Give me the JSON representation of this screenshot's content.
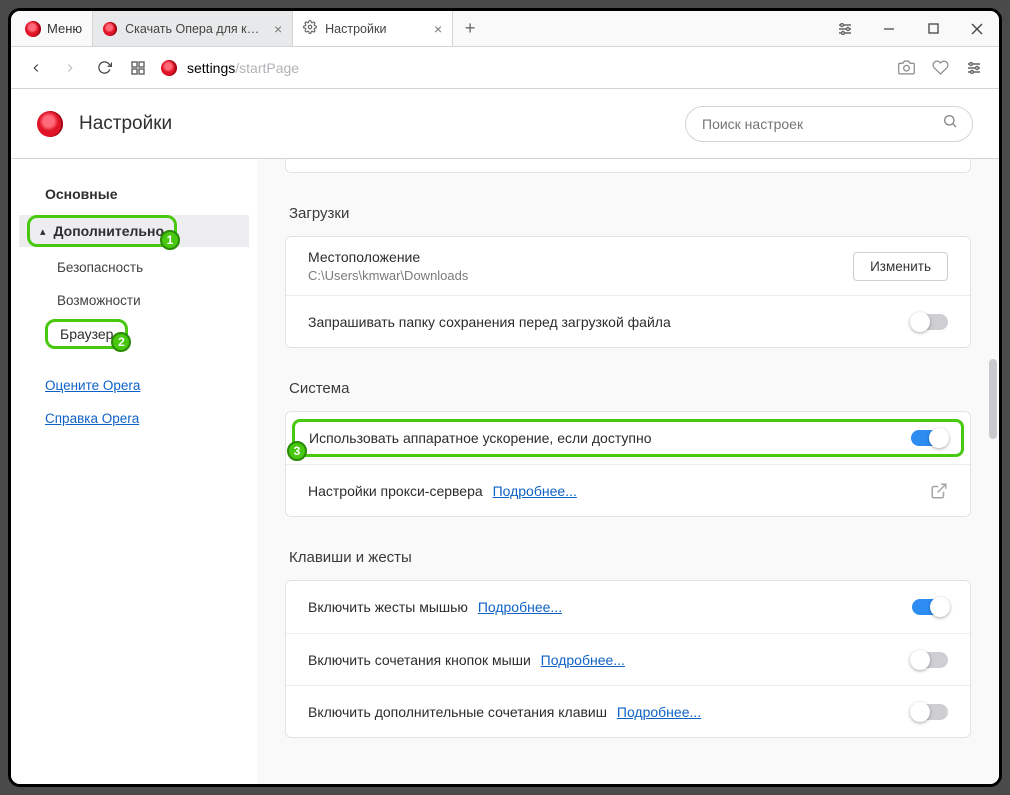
{
  "window": {
    "menu_label": "Меню",
    "tabs": [
      {
        "title": "Скачать Опера для компьютера",
        "icon": "opera"
      },
      {
        "title": "Настройки",
        "icon": "gear"
      }
    ]
  },
  "addressbar": {
    "url_prefix": "settings",
    "url_rest": "/startPage"
  },
  "header": {
    "title": "Настройки",
    "search_placeholder": "Поиск настроек"
  },
  "sidebar": {
    "basic": "Основные",
    "advanced": "Дополнительно",
    "security": "Безопасность",
    "features": "Возможности",
    "browser": "Браузер",
    "rate": "Оцените Opera",
    "help": "Справка Opera"
  },
  "callouts": {
    "n1": "1",
    "n2": "2",
    "n3": "3"
  },
  "sections": {
    "downloads": {
      "title": "Загрузки",
      "location_label": "Местоположение",
      "location_value": "C:\\Users\\kmwar\\Downloads",
      "change_btn": "Изменить",
      "ask_before": "Запрашивать папку сохранения перед загрузкой файла"
    },
    "system": {
      "title": "Система",
      "hw_accel": "Использовать аппаратное ускорение, если доступно",
      "proxy": "Настройки прокси-сервера",
      "proxy_more": "Подробнее..."
    },
    "gestures": {
      "title": "Клавиши и жесты",
      "mouse_gestures": "Включить жесты мышью",
      "mouse_more": "Подробнее...",
      "rocker": "Включить сочетания кнопок мыши",
      "rocker_more": "Подробнее...",
      "extra_keys": "Включить дополнительные сочетания клавиш",
      "extra_more": "Подробнее..."
    }
  }
}
